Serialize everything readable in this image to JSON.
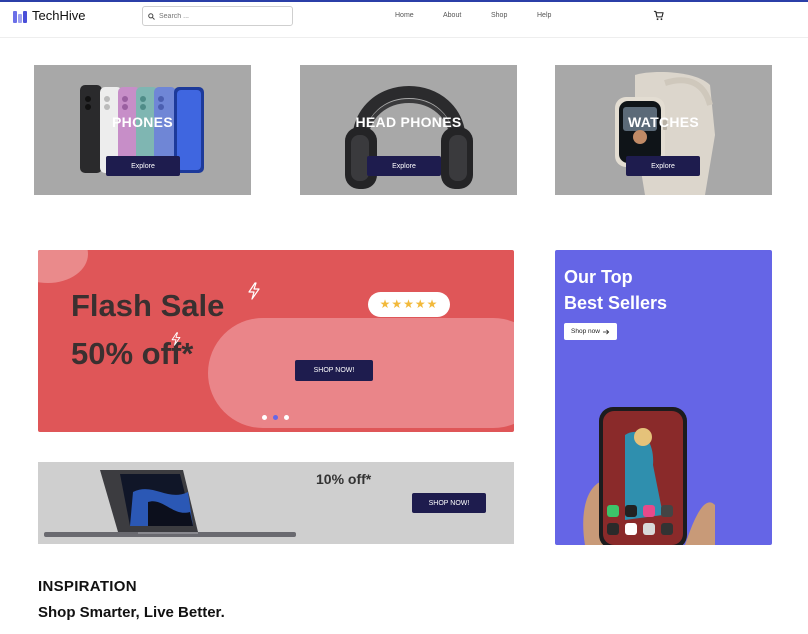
{
  "brand": {
    "name": "TechHive",
    "colors": {
      "accent": "#6565e6",
      "dark_button": "#1e1c4e",
      "flash_red": "#df5658"
    }
  },
  "search": {
    "placeholder": "Search ...",
    "value": ""
  },
  "nav": {
    "items": [
      "Home",
      "About",
      "Shop",
      "Help"
    ]
  },
  "cart": {
    "icon": "shopping-cart-icon"
  },
  "categories": [
    {
      "title": "PHONES",
      "button": "Explore",
      "image": "smartphones-image"
    },
    {
      "title": "HEAD PHONES",
      "button": "Explore",
      "image": "headphones-image"
    },
    {
      "title": "WATCHES",
      "button": "Explore",
      "image": "smartwatch-image"
    }
  ],
  "flash": {
    "title": "Flash Sale",
    "discount": "50% off*",
    "rating": "★★★★★",
    "button": "SHOP NOW!",
    "carousel": {
      "count": 3,
      "active": 1
    }
  },
  "laptop_promo": {
    "discount": "10% off*",
    "button": "SHOP NOW!",
    "image": "laptop-image"
  },
  "best_sellers": {
    "line1": "Our Top",
    "line2": "Best Sellers",
    "button": "Shop now",
    "image": "phone-in-hand-image"
  },
  "inspiration": {
    "heading": "INSPIRATION",
    "tagline": "Shop Smarter, Live Better."
  }
}
